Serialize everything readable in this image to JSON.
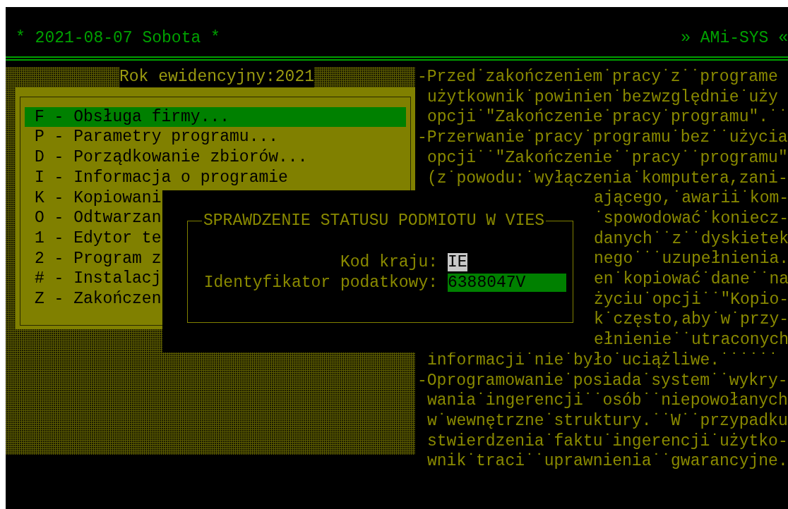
{
  "header": {
    "date": "* 2021-08-07 Sobota *",
    "app_name": "» AMi-SYS «"
  },
  "menu": {
    "title": "Rok ewidencyjny:2021",
    "items": [
      {
        "text": "F - Obsługa firmy...",
        "selected": true
      },
      {
        "text": "P - Parametry programu...",
        "selected": false
      },
      {
        "text": "D - Porządkowanie zbiorów...",
        "selected": false
      },
      {
        "text": "I - Informacja o programie",
        "selected": false
      },
      {
        "text": "K - Kopiowani",
        "selected": false
      },
      {
        "text": "O - Odtwarzan",
        "selected": false
      },
      {
        "text": "1 - Edytor te",
        "selected": false
      },
      {
        "text": "2 - Program z",
        "selected": false
      },
      {
        "text": "# - Instalacj",
        "selected": false
      },
      {
        "text": "Z - Zakończen",
        "selected": false
      }
    ]
  },
  "notes": [
    {
      "kind": "start",
      "text": "-Przed˙zakończeniem˙pracy˙z˙˙programe"
    },
    {
      "kind": "continuation",
      "text": "użytkownik˙powinien˙bezwzględnie˙uży"
    },
    {
      "kind": "continuation",
      "text": "opcji˙\"Zakończenie˙pracy˙programu\".˙˙"
    },
    {
      "kind": "start",
      "text": "-Przerwanie˙pracy˙programu˙bez˙˙użycia"
    },
    {
      "kind": "continuation",
      "text": "opcji˙˙\"Zakończenie˙˙pracy˙˙programu\""
    },
    {
      "kind": "continuation",
      "text": "(z˙powodu:˙wyłączenia˙komputera,zani-"
    },
    {
      "kind": "partial",
      "text": "ającego,˙awarii˙kom-"
    },
    {
      "kind": "partial",
      "text": "˙spowodować˙koniecz-"
    },
    {
      "kind": "partial",
      "text": "danych˙˙z˙˙dyskietek"
    },
    {
      "kind": "partial",
      "text": "nego˙˙˙uzupełnienia."
    },
    {
      "kind": "partial",
      "text": "en˙kopiować˙dane˙˙na"
    },
    {
      "kind": "partial",
      "text": "życiu˙opcji˙˙\"Kopio-"
    },
    {
      "kind": "partial",
      "text": "k˙często,aby˙w˙przy-"
    },
    {
      "kind": "partial",
      "text": "ełnienie˙˙utraconych"
    },
    {
      "kind": "continuation",
      "text": "informacji˙nie˙było˙uciążliwe.˙˙˙˙˙˙"
    },
    {
      "kind": "start",
      "text": "-Oprogramowanie˙posiada˙system˙˙wykry-"
    },
    {
      "kind": "continuation",
      "text": "wania˙ingerencji˙˙osób˙˙niepowołanych"
    },
    {
      "kind": "continuation",
      "text": "w˙wewnętrzne˙struktury.˙˙W˙˙przypadku"
    },
    {
      "kind": "continuation",
      "text": "stwierdzenia˙faktu˙ingerencji˙użytko-"
    },
    {
      "kind": "continuation",
      "text": "wnik˙traci˙˙uprawnienia˙˙gwarancyjne."
    }
  ],
  "dialog": {
    "title": "SPRAWDZENIE STATUSU PODMIOTU W VIES",
    "fields": [
      {
        "label": "Kod kraju:",
        "value": "IE",
        "selected": false
      },
      {
        "label": "Identyfikator podatkowy:",
        "value": "6388047V",
        "selected": true
      }
    ]
  }
}
